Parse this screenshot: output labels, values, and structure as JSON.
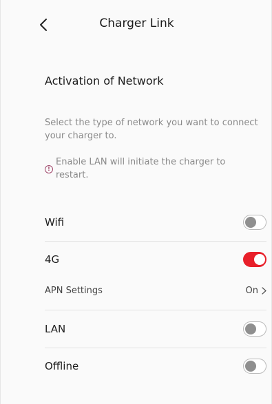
{
  "header": {
    "title": "Charger Link",
    "back_icon": "chevron-left-icon"
  },
  "section": {
    "title": "Activation of Network",
    "description": "Select the type of network you want to connect your charger to.",
    "notice_icon": "info-icon",
    "notice_icon_glyph": "!",
    "notice": "Enable LAN will initiate the charger to restart."
  },
  "networks": {
    "wifi": {
      "label": "Wifi",
      "enabled": false
    },
    "fourg": {
      "label": "4G",
      "enabled": true
    },
    "apn": {
      "label": "APN Settings",
      "value": "On"
    },
    "lan": {
      "label": "LAN",
      "enabled": false
    },
    "offline": {
      "label": "Offline",
      "enabled": false
    }
  },
  "colors": {
    "accent": "#e8202a",
    "toggle_off_knob": "#8f8f8f",
    "muted_text": "#8a8a8a"
  }
}
